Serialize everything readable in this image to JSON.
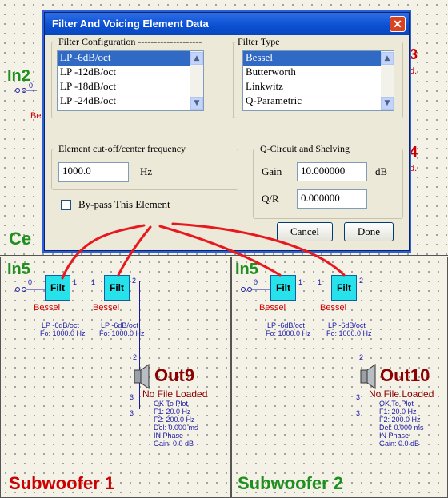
{
  "canvas": {
    "top_left": {
      "label": "In2",
      "sub": "Be",
      "numbers": [
        "0"
      ]
    },
    "top_right_letters": [
      "3",
      "d.",
      "4",
      "d."
    ],
    "top_bottom_label": "Ce",
    "panels": [
      {
        "in_label": "In5",
        "port_in": "0",
        "filt1": {
          "label": "Filt",
          "type": "Bessel",
          "line1": "LP -6dB/oct",
          "line2": "Fo: 1000.0 Hz",
          "port_out": "1"
        },
        "filt2": {
          "label": "Filt",
          "type": "Bessel",
          "line1": "LP -6dB/oct",
          "line2": "Fo: 1000.0 Hz",
          "port_in": "1",
          "port_out": "2"
        },
        "speaker": {
          "port_top": "2",
          "port_a": "3",
          "port_b": "3",
          "out_label": "Out9",
          "status": "No File Loaded",
          "info": [
            "OK To Plot",
            "F1: 20.0 Hz",
            "F2: 200.0 Hz",
            "Del: 0.000 ms",
            "IN Phase",
            "Gain: 0.0 dB"
          ]
        },
        "title": "Subwoofer 1"
      },
      {
        "in_label": "In5",
        "port_in": "0",
        "filt1": {
          "label": "Filt",
          "type": "Bessel",
          "line1": "LP -6dB/oct",
          "line2": "Fo: 1000.0 Hz",
          "port_out": "1"
        },
        "filt2": {
          "label": "Filt",
          "type": "Bessel",
          "line1": "LP -6dB/oct",
          "line2": "Fo: 1000.0 Hz",
          "port_in": "1",
          "port_out": "2"
        },
        "speaker": {
          "port_top": "2",
          "port_a": "3",
          "port_b": "3",
          "out_label": "Out10",
          "status": "No File Loaded",
          "info": [
            "OK To Plot",
            "F1: 20.0 Hz",
            "F2: 200.0 Hz",
            "Del: 0.000 ms",
            "IN Phase",
            "Gain: 0.0 dB"
          ]
        },
        "title": "Subwoofer 2"
      }
    ]
  },
  "dialog": {
    "title": "Filter And Voicing Element Data",
    "close_glyph": "✕",
    "filter_config": {
      "label": "Filter Configuration --------------------",
      "items": [
        "LP -6dB/oct",
        "LP -12dB/oct",
        "LP -18dB/oct",
        "LP -24dB/oct"
      ],
      "selected": 0
    },
    "filter_type": {
      "label": "Filter Type",
      "items": [
        "Bessel",
        "Butterworth",
        "Linkwitz",
        "Q-Parametric"
      ],
      "selected": 0
    },
    "cutoff": {
      "label": "Element cut-off/center frequency",
      "value": "1000.0",
      "unit": "Hz"
    },
    "qcircuit": {
      "label": "Q-Circuit and Shelving",
      "gain_label": "Gain",
      "gain_value": "10.000000",
      "gain_unit": "dB",
      "q_label": "Q/R",
      "q_value": "0.000000"
    },
    "bypass": {
      "label": "By-pass This Element",
      "checked": false
    },
    "cancel_label": "Cancel",
    "done_label": "Done"
  },
  "colors": {
    "annotation": "#e8181e",
    "filt_fill": "#27e2ea"
  }
}
